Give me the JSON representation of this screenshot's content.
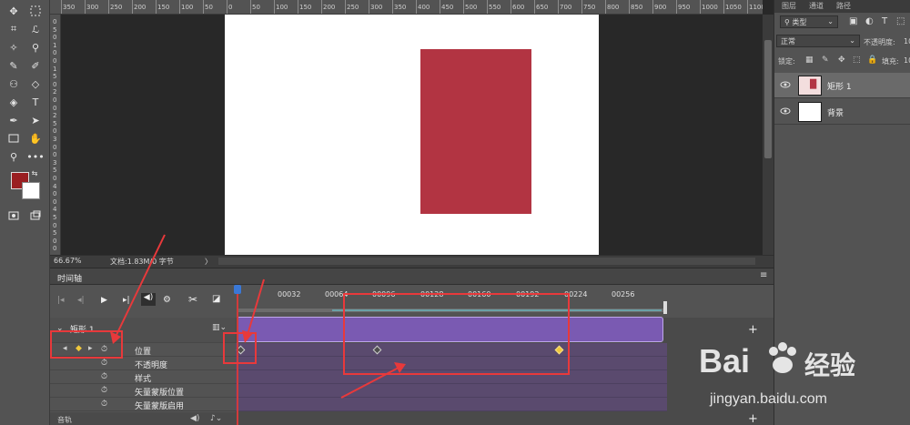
{
  "ruler": {
    "top_labels": [
      "350",
      "300",
      "250",
      "200",
      "150",
      "100",
      "50",
      "0",
      "50",
      "100",
      "150",
      "200",
      "250",
      "300",
      "350",
      "400",
      "450",
      "500",
      "550",
      "600",
      "650",
      "700",
      "750",
      "800",
      "850",
      "900",
      "950",
      "1000",
      "1050",
      "1100"
    ],
    "left_labels": [
      "0",
      "5",
      "0",
      "1",
      "0",
      "0",
      "1",
      "5",
      "0",
      "2",
      "0",
      "0",
      "2",
      "5",
      "0",
      "3",
      "0",
      "0",
      "3",
      "5",
      "0",
      "4",
      "0",
      "0",
      "4",
      "5",
      "0",
      "5",
      "0",
      "0"
    ]
  },
  "status": {
    "zoom": "66.67%",
    "doc": "文档:1.83M/0 字节",
    "arrow": "〉"
  },
  "right_panel": {
    "tabs": [
      "图层",
      "通道",
      "路径"
    ],
    "filter_label": "类型",
    "blend_mode": "正常",
    "opacity_label": "不透明度:",
    "opacity_value": "10",
    "lock_label": "锁定:",
    "fill_label": "填充:",
    "fill_value": "10",
    "layers": [
      {
        "name": "矩形 1",
        "selected": true
      },
      {
        "name": "背景",
        "selected": false
      }
    ]
  },
  "timeline": {
    "title": "时间轴",
    "ticks": [
      "00032",
      "00064",
      "00096",
      "00128",
      "00160",
      "00192",
      "00224",
      "00256"
    ],
    "layer_name": "矩形 1",
    "properties": [
      "位置",
      "不透明度",
      "样式",
      "矢量蒙版位置",
      "矢量蒙版启用"
    ],
    "audio_label": "音轨",
    "add_label": "+"
  },
  "watermark": {
    "brand": "Bai",
    "brand_cn": "经验",
    "url": "jingyan.baidu.com"
  },
  "colors": {
    "rect": "#b23442",
    "foreground": "#9a1f22",
    "track": "#7a5ab2",
    "annotation": "#e8393b"
  }
}
